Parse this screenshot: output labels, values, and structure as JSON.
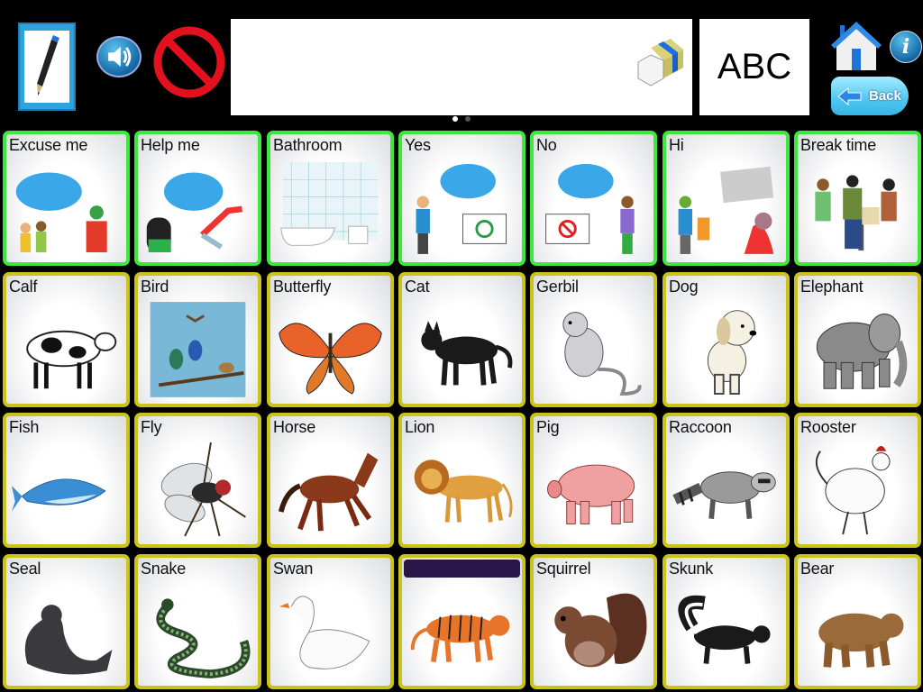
{
  "toolbar": {
    "compose_icon": "pencil-notepad-icon",
    "speak_icon": "speaker-icon",
    "clear_icon": "prohibited-icon",
    "message_text": "",
    "eraser_icon": "eraser-icon",
    "keyboard_label": "ABC",
    "home_icon": "home-icon",
    "info_label": "i",
    "back_label": "Back"
  },
  "pager": {
    "page_count": 2,
    "current_page": 1,
    "active_color": "#ffffff",
    "inactive_color": "#555555"
  },
  "colors": {
    "core_border": "#3de83d",
    "vocab_border": "#c9c31a",
    "blank_label_bar": "#2a1548"
  },
  "grid": {
    "rows": [
      [
        {
          "label": "Excuse me",
          "image": "excuse-me-scene",
          "type": "core"
        },
        {
          "label": "Help me",
          "image": "help-me-scene",
          "type": "core"
        },
        {
          "label": "Bathroom",
          "image": "bathroom",
          "type": "core"
        },
        {
          "label": "Yes",
          "image": "yes-scene",
          "type": "core"
        },
        {
          "label": "No",
          "image": "no-scene",
          "type": "core"
        },
        {
          "label": "Hi",
          "image": "hi-scene",
          "type": "core"
        },
        {
          "label": "Break time",
          "image": "break-time-scene",
          "type": "core"
        }
      ],
      [
        {
          "label": "Calf",
          "image": "calf",
          "type": "vocab"
        },
        {
          "label": "Bird",
          "image": "birds",
          "type": "vocab"
        },
        {
          "label": "Butterfly",
          "image": "butterfly",
          "type": "vocab"
        },
        {
          "label": "Cat",
          "image": "cat",
          "type": "vocab"
        },
        {
          "label": "Gerbil",
          "image": "gerbil",
          "type": "vocab"
        },
        {
          "label": "Dog",
          "image": "dog",
          "type": "vocab"
        },
        {
          "label": "Elephant",
          "image": "elephant",
          "type": "vocab"
        }
      ],
      [
        {
          "label": "Fish",
          "image": "fish",
          "type": "vocab"
        },
        {
          "label": "Fly",
          "image": "fly",
          "type": "vocab"
        },
        {
          "label": "Horse",
          "image": "horse",
          "type": "vocab"
        },
        {
          "label": "Lion",
          "image": "lion",
          "type": "vocab"
        },
        {
          "label": "Pig",
          "image": "pig",
          "type": "vocab"
        },
        {
          "label": "Raccoon",
          "image": "raccoon",
          "type": "vocab"
        },
        {
          "label": "Rooster",
          "image": "rooster",
          "type": "vocab"
        }
      ],
      [
        {
          "label": "Seal",
          "image": "seal",
          "type": "vocab"
        },
        {
          "label": "Snake",
          "image": "snake",
          "type": "vocab"
        },
        {
          "label": "Swan",
          "image": "swan",
          "type": "vocab"
        },
        {
          "label": "",
          "image": "tiger",
          "type": "vocab",
          "label_hidden": true
        },
        {
          "label": "Squirrel",
          "image": "squirrel",
          "type": "vocab"
        },
        {
          "label": "Skunk",
          "image": "skunk",
          "type": "vocab"
        },
        {
          "label": "Bear",
          "image": "bear",
          "type": "vocab"
        }
      ]
    ]
  }
}
